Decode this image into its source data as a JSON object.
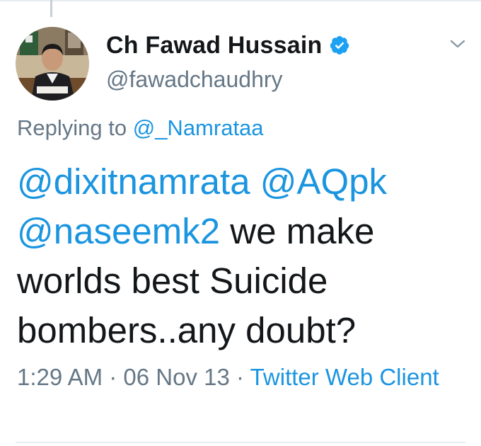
{
  "tweet": {
    "author": {
      "display_name": "Ch Fawad Hussain",
      "handle": "@fawadchaudhry",
      "verified": true
    },
    "replying_to": {
      "prefix": "Replying to",
      "handle": "@_Namrataa"
    },
    "text": {
      "mentions": [
        "@dixitnamrata",
        "@AQpk",
        "@naseemk2"
      ],
      "body_line1": " we make",
      "body_rest": "worlds best Suicide bombers..any doubt?"
    },
    "meta": {
      "time": "1:29 AM",
      "separator": " · ",
      "date": "06 Nov 13",
      "source": "Twitter Web Client"
    }
  },
  "icons": {
    "verified": "verified-badge-icon",
    "menu": "chevron-down-icon"
  },
  "colors": {
    "link": "#1b95e0",
    "secondary_text": "#657786",
    "primary_text": "#14171a",
    "verified": "#1da1f2"
  }
}
